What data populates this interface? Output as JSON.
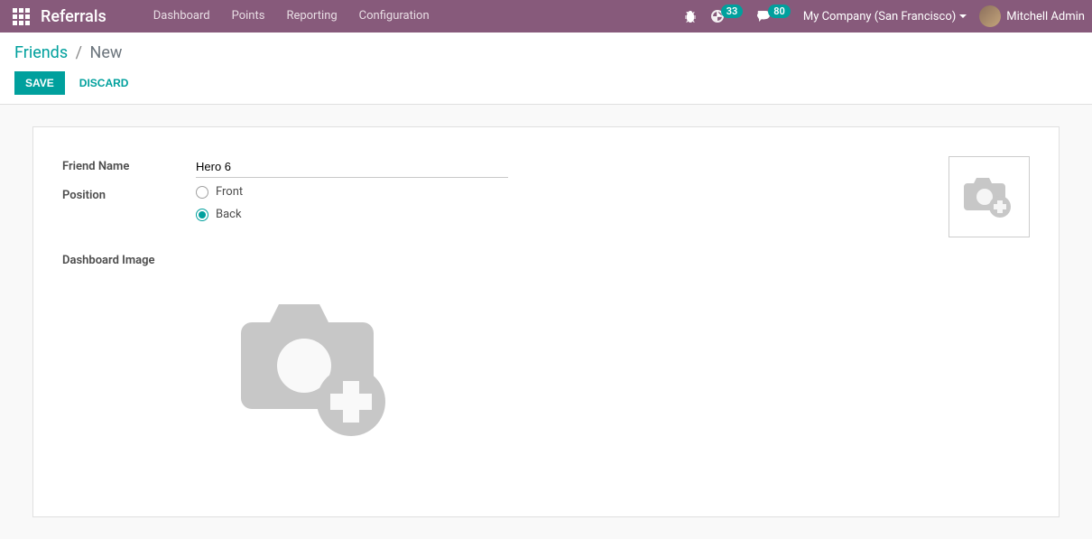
{
  "topbar": {
    "brand": "Referrals",
    "nav": {
      "dashboard": "Dashboard",
      "points": "Points",
      "reporting": "Reporting",
      "configuration": "Configuration"
    },
    "activities_count": "33",
    "messages_count": "80",
    "company": "My Company (San Francisco)",
    "user": "Mitchell Admin"
  },
  "breadcrumb": {
    "parent": "Friends",
    "current": "New"
  },
  "buttons": {
    "save": "Save",
    "discard": "Discard"
  },
  "form": {
    "friend_name_label": "Friend Name",
    "friend_name_value": "Hero 6",
    "position_label": "Position",
    "position_options": {
      "front": "Front",
      "back": "Back"
    },
    "position_selected": "back",
    "dashboard_image_label": "Dashboard Image"
  }
}
